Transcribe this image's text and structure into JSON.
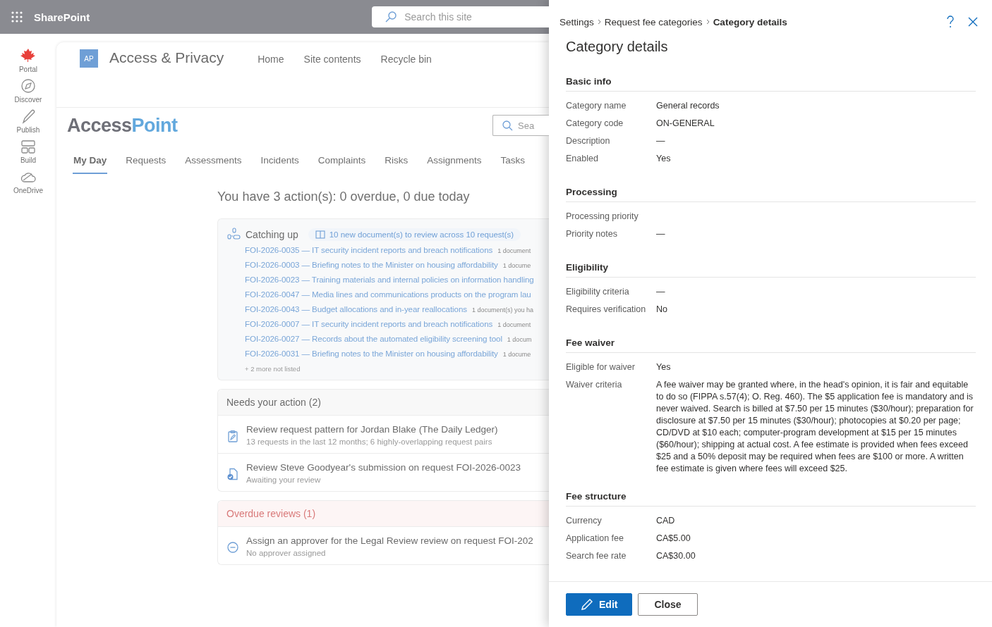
{
  "app_bar": {
    "title": "SharePoint",
    "search": {
      "placeholder": "Search this site"
    }
  },
  "rail": [
    {
      "label": "Portal"
    },
    {
      "label": "Discover"
    },
    {
      "label": "Publish"
    },
    {
      "label": "Build"
    },
    {
      "label": "OneDrive"
    }
  ],
  "site": {
    "logo": "AP",
    "title": "Access & Privacy",
    "nav": [
      "Home",
      "Site contents",
      "Recycle bin"
    ]
  },
  "app": {
    "brand": [
      "Access",
      "Point"
    ],
    "search": {
      "placeholder": "Sea"
    },
    "tabs": [
      {
        "label": "My Day",
        "selected": true
      },
      {
        "label": "Requests",
        "selected": false
      },
      {
        "label": "Assessments",
        "selected": false
      },
      {
        "label": "Incidents",
        "selected": false
      },
      {
        "label": "Complaints",
        "selected": false
      },
      {
        "label": "Risks",
        "selected": false
      },
      {
        "label": "Assignments",
        "selected": false
      },
      {
        "label": "Tasks",
        "selected": false
      }
    ]
  },
  "summary": "You have 3 action(s): 0 overdue, 0 due today",
  "catching_up": {
    "title": "Catching up",
    "badge": "10 new document(s) to review across 10 request(s)",
    "items": [
      {
        "text": "FOI-2026-0035 — IT security incident reports and breach notifications",
        "meta": "1 document"
      },
      {
        "text": "FOI-2026-0003 — Briefing notes to the Minister on housing affordability",
        "meta": "1 docume"
      },
      {
        "text": "FOI-2026-0023 — Training materials and internal policies on information handling"
      },
      {
        "text": "FOI-2026-0047 — Media lines and communications products on the program lau"
      },
      {
        "text": "FOI-2026-0043 — Budget allocations and in-year reallocations",
        "meta": "1 document(s) you ha"
      },
      {
        "text": "FOI-2026-0007 — IT security incident reports and breach notifications",
        "meta": "1 document"
      },
      {
        "text": "FOI-2026-0027 — Records about the automated eligibility screening tool",
        "meta": "1 docum"
      },
      {
        "text": "FOI-2026-0031 — Briefing notes to the Minister on housing affordability",
        "meta": "1 docume"
      }
    ],
    "more": "+ 2 more not listed"
  },
  "sections": [
    {
      "title": "Needs your action (2)",
      "kind": "normal",
      "items": [
        {
          "title": "Review request pattern for Jordan Blake (The Daily Ledger)",
          "subtitle": "13 requests in the last 12 months; 6 highly-overlapping request pairs",
          "kind": "pattern"
        },
        {
          "title": "Review Steve Goodyear's submission on request FOI-2026-0023",
          "subtitle": "Awaiting your review",
          "kind": "submission"
        }
      ]
    },
    {
      "title": "Overdue reviews (1)",
      "kind": "overdue",
      "items": [
        {
          "title": "Assign an approver for the Legal Review review on request FOI-202",
          "subtitle": "No approver assigned",
          "kind": "approver"
        }
      ]
    }
  ],
  "panel": {
    "breadcrumb": [
      {
        "label": "Settings",
        "current": false
      },
      {
        "label": "Request fee categories",
        "current": false
      },
      {
        "label": "Category details",
        "current": true
      }
    ],
    "title": "Category details",
    "sections": [
      {
        "title": "Basic info",
        "fields": [
          {
            "label": "Category name",
            "value": "General records"
          },
          {
            "label": "Category code",
            "value": "ON-GENERAL"
          },
          {
            "label": "Description",
            "value": "—"
          },
          {
            "label": "Enabled",
            "value": "Yes"
          }
        ]
      },
      {
        "title": "Processing",
        "fields": [
          {
            "label": "Processing priority"
          },
          {
            "label": "Priority notes",
            "value": "—"
          }
        ]
      },
      {
        "title": "Eligibility",
        "fields": [
          {
            "label": "Eligibility criteria",
            "value": "—"
          },
          {
            "label": "Requires verification",
            "value": "No"
          }
        ]
      },
      {
        "title": "Fee waiver",
        "fields": [
          {
            "label": "Eligible for waiver",
            "value": "Yes"
          },
          {
            "label": "Waiver criteria",
            "value": "A fee waiver may be granted where, in the head's opinion, it is fair and equitable to do so (FIPPA s.57(4); O. Reg. 460). The $5 application fee is mandatory and is never waived. Search is billed at $7.50 per 15 minutes ($30/hour); preparation for disclosure at $7.50 per 15 minutes ($30/hour); photocopies at $0.20 per page; CD/DVD at $10 each; computer-program development at $15 per 15 minutes ($60/hour); shipping at actual cost. A fee estimate is provided when fees exceed $25 and a 50% deposit may be required when fees are $100 or more. A written fee estimate is given where fees will exceed $25."
          }
        ]
      },
      {
        "title": "Fee structure",
        "fields": [
          {
            "label": "Currency",
            "value": "CAD"
          },
          {
            "label": "Application fee",
            "value": "CA$5.00"
          },
          {
            "label": "Search fee rate",
            "value": "CA$30.00"
          }
        ]
      }
    ],
    "buttons": [
      {
        "label": "Edit",
        "kind": "primary"
      },
      {
        "label": "Close",
        "kind": "secondary"
      }
    ]
  }
}
